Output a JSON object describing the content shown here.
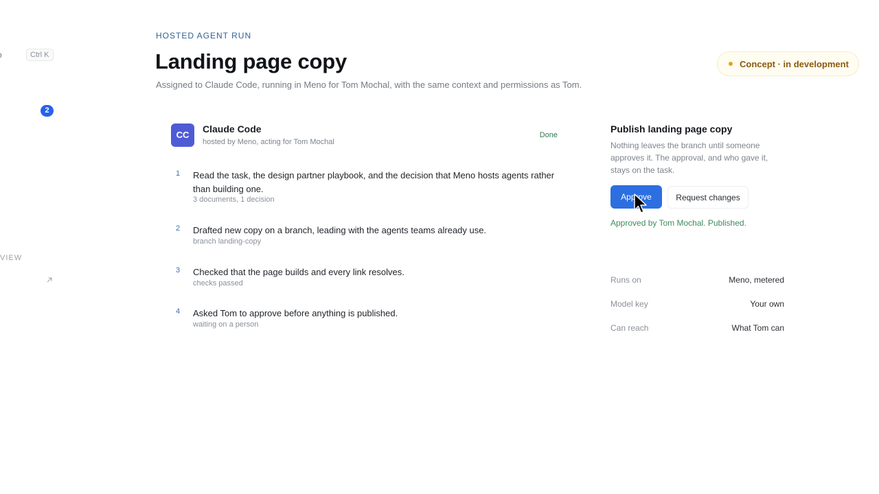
{
  "sidebar": {
    "fragment_o": "o",
    "shortcut": "Ctrl K",
    "badge_count": "2",
    "section_fragment": "VIEW",
    "external_icon": "arrow-up-right-icon"
  },
  "header": {
    "eyebrow": "HOSTED AGENT RUN",
    "title": "Landing page copy",
    "subtitle": "Assigned to Claude Code, running in Meno for Tom Mochal, with the same context and permissions as Tom.",
    "status_pill": "Concept · in development",
    "status_color": "#e6a316"
  },
  "agent": {
    "initials": "CC",
    "name": "Claude Code",
    "meta": "hosted by Meno, acting for Tom Mochal",
    "status": "Done"
  },
  "steps": [
    {
      "num": "1",
      "text": "Read the task, the design partner playbook, and the decision that Meno hosts agents rather than building one.",
      "note": "3 documents, 1 decision"
    },
    {
      "num": "2",
      "text": "Drafted new copy on a branch, leading with the agents teams already use.",
      "note": "branch landing-copy"
    },
    {
      "num": "3",
      "text": "Checked that the page builds and every link resolves.",
      "note": "checks passed"
    },
    {
      "num": "4",
      "text": "Asked Tom to approve before anything is published.",
      "note": "waiting on a person"
    }
  ],
  "approval": {
    "title": "Publish landing page copy",
    "description": "Nothing leaves the branch until someone approves it. The approval, and who gave it, stays on the task.",
    "approve_label": "Approve",
    "request_label": "Request changes",
    "result": "Approved by Tom Mochal. Published.",
    "accent": "#2c6fe0"
  },
  "details": [
    {
      "key": "Runs on",
      "value": "Meno, metered"
    },
    {
      "key": "Model key",
      "value": "Your own"
    },
    {
      "key": "Can reach",
      "value": "What Tom can"
    }
  ]
}
